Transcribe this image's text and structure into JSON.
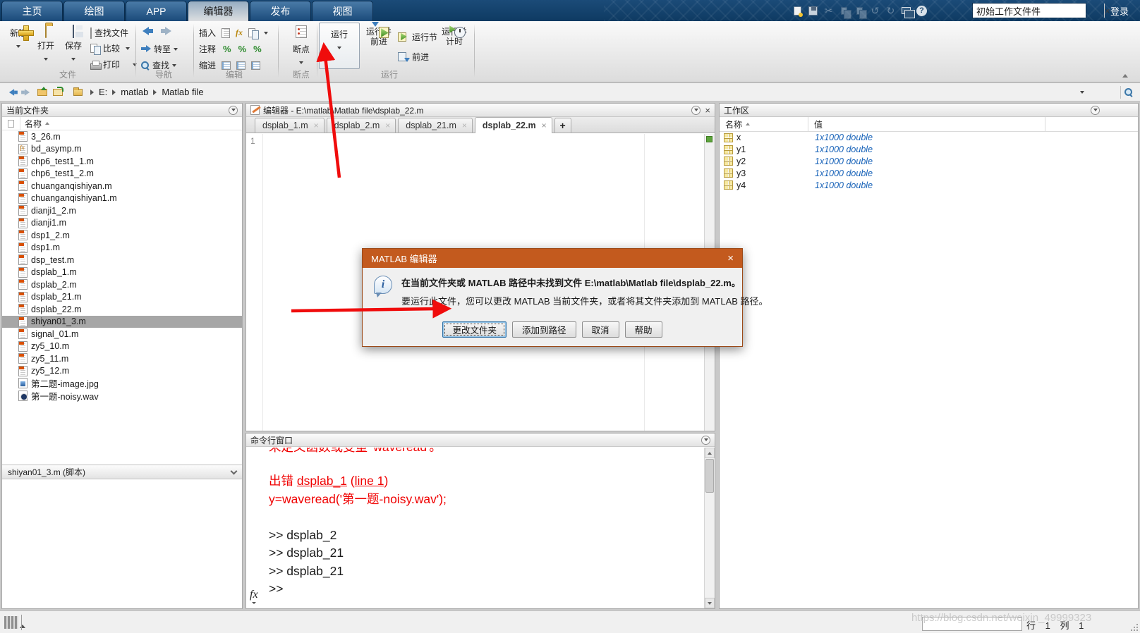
{
  "icons": {
    "cut": "✂",
    "undo": "↺",
    "redo": "↻",
    "help": "?",
    "close": "×"
  },
  "menubar": {
    "tabs": [
      {
        "label": "主页"
      },
      {
        "label": "绘图"
      },
      {
        "label": "APP"
      },
      {
        "label": "编辑器",
        "active": true
      },
      {
        "label": "发布"
      },
      {
        "label": "视图"
      }
    ],
    "search_value": "初始工作文件件",
    "login_label": "登录"
  },
  "ribbon": {
    "file_group": {
      "label": "文件",
      "buttons": [
        {
          "label": "新建"
        },
        {
          "label": "打开"
        },
        {
          "label": "保存"
        }
      ],
      "small_buttons": [
        {
          "label": "查找文件"
        },
        {
          "label": "比较"
        },
        {
          "label": "打印"
        }
      ]
    },
    "nav_group": {
      "label": "导航",
      "goto_label": "转至",
      "find_label": "查找"
    },
    "edit_group": {
      "label": "编辑",
      "insert_label": "插入",
      "comment_label": "注释",
      "indent_label": "缩进",
      "fx_glyph": "fx",
      "percent_glyph": "%"
    },
    "breakpoint_group": {
      "label": "断点",
      "button_label": "断点"
    },
    "run_group": {
      "label": "运行",
      "run_label": "运行",
      "run_advance_line1": "运行并",
      "run_advance_line2": "前进",
      "run_section_label": "运行节",
      "advance_label": "前进",
      "run_time_line1": "运行并",
      "run_time_line2": "计时"
    }
  },
  "addressbar": {
    "segments": [
      "E:",
      "matlab",
      "Matlab file"
    ]
  },
  "current_folder": {
    "title": "当前文件夹",
    "name_column": "名称",
    "files": [
      {
        "name": "3_26.m",
        "type": "script"
      },
      {
        "name": "bd_asymp.m",
        "type": "function"
      },
      {
        "name": "chp6_test1_1.m",
        "type": "script"
      },
      {
        "name": "chp6_test1_2.m",
        "type": "script"
      },
      {
        "name": "chuanganqishiyan.m",
        "type": "script"
      },
      {
        "name": "chuanganqishiyan1.m",
        "type": "script"
      },
      {
        "name": "dianji1_2.m",
        "type": "script"
      },
      {
        "name": "dianji1.m",
        "type": "script"
      },
      {
        "name": "dsp1_2.m",
        "type": "script"
      },
      {
        "name": "dsp1.m",
        "type": "script"
      },
      {
        "name": "dsp_test.m",
        "type": "script"
      },
      {
        "name": "dsplab_1.m",
        "type": "script"
      },
      {
        "name": "dsplab_2.m",
        "type": "script"
      },
      {
        "name": "dsplab_21.m",
        "type": "script"
      },
      {
        "name": "dsplab_22.m",
        "type": "script"
      },
      {
        "name": "shiyan01_3.m",
        "type": "script",
        "selected": true
      },
      {
        "name": "signal_01.m",
        "type": "script"
      },
      {
        "name": "zy5_10.m",
        "type": "script"
      },
      {
        "name": "zy5_11.m",
        "type": "script"
      },
      {
        "name": "zy5_12.m",
        "type": "script"
      },
      {
        "name": "第二题-image.jpg",
        "type": "image"
      },
      {
        "name": "第一题-noisy.wav",
        "type": "audio"
      }
    ],
    "detail_label": "shiyan01_3.m  (脚本)"
  },
  "editor": {
    "title": "编辑器 - E:\\matlab\\Matlab file\\dsplab_22.m",
    "tabs": [
      {
        "label": "dsplab_1.m"
      },
      {
        "label": "dsplab_2.m"
      },
      {
        "label": "dsplab_21.m"
      },
      {
        "label": "dsplab_22.m",
        "active": true
      }
    ],
    "new_tab_label": "+",
    "line_number": "1"
  },
  "command_window": {
    "title": "命令行窗口",
    "lines": [
      {
        "type": "error_clipped",
        "text": "未定义函数或变量 'waveread'。"
      },
      {
        "type": "error_rich",
        "parts": [
          {
            "text": "出错 ",
            "link": false
          },
          {
            "text": "dsplab_1",
            "link": true
          },
          {
            "text": " (",
            "link": false
          },
          {
            "text": "line 1",
            "link": true
          },
          {
            "text": ")",
            "link": false
          }
        ]
      },
      {
        "type": "error",
        "text": "y=waveread('第一题-noisy.wav');"
      },
      {
        "type": "blank",
        "text": " "
      },
      {
        "type": "command",
        "text": ">> dsplab_2"
      },
      {
        "type": "command",
        "text": ">> dsplab_21"
      },
      {
        "type": "command",
        "text": ">> dsplab_21"
      }
    ],
    "prompt": ">>",
    "fx_label": "fx"
  },
  "workspace": {
    "title": "工作区",
    "columns": [
      "名称",
      "值"
    ],
    "rows": [
      {
        "name": "x",
        "value": "1x1000 double"
      },
      {
        "name": "y1",
        "value": "1x1000 double"
      },
      {
        "name": "y2",
        "value": "1x1000 double"
      },
      {
        "name": "y3",
        "value": "1x1000 double"
      },
      {
        "name": "y4",
        "value": "1x1000 double"
      }
    ]
  },
  "dialog": {
    "title": "MATLAB 编辑器",
    "message_bold": "在当前文件夹或 MATLAB 路径中未找到文件 E:\\matlab\\Matlab file\\dsplab_22.m。",
    "message_body": "要运行此文件，您可以更改 MATLAB 当前文件夹，或者将其文件夹添加到 MATLAB 路径。",
    "buttons": [
      {
        "label": "更改文件夹",
        "default": true
      },
      {
        "label": "添加到路径"
      },
      {
        "label": "取消"
      },
      {
        "label": "帮助"
      }
    ]
  },
  "statusbar": {
    "row_label": "行",
    "row_value": "1",
    "col_label": "列",
    "col_value": "1",
    "watermark": "https://blog.csdn.net/weixin_49999323"
  }
}
